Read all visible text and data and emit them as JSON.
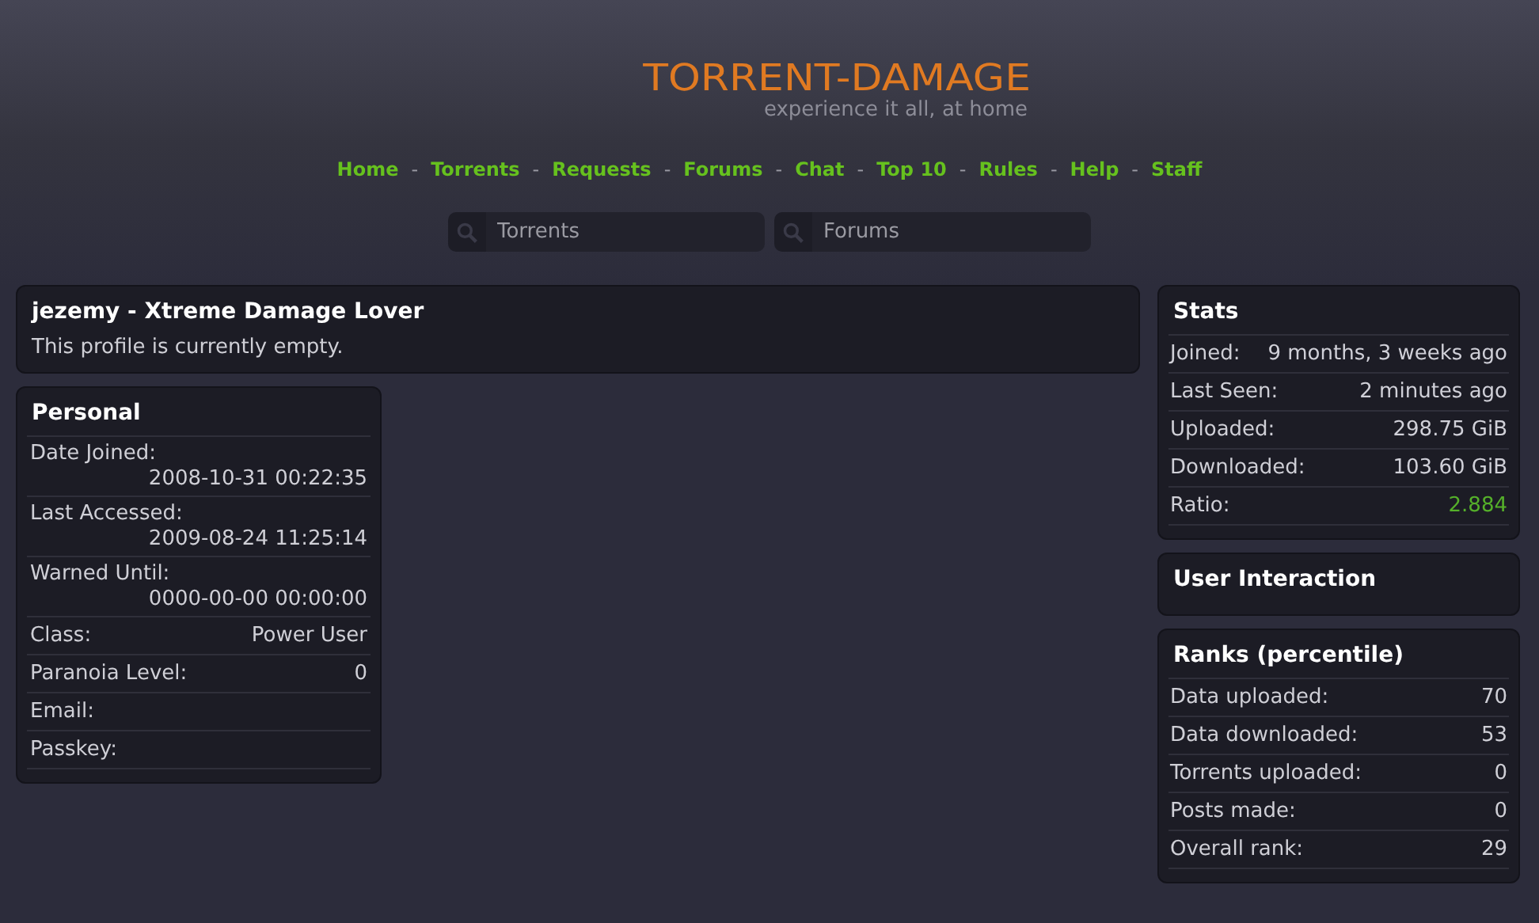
{
  "header": {
    "logo": "TORRENT-DAMAGE",
    "tagline": "experience it all, at home"
  },
  "nav": {
    "separator": "-",
    "links": [
      "Home",
      "Torrents",
      "Requests",
      "Forums",
      "Chat",
      "Top 10",
      "Rules",
      "Help",
      "Staff"
    ]
  },
  "search_fields": [
    {
      "placeholder": "Torrents"
    },
    {
      "placeholder": "Forums"
    }
  ],
  "profile": {
    "title": "jezemy - Xtreme Damage Lover",
    "body": "This profile is currently empty."
  },
  "personal": {
    "title": "Personal",
    "rows": [
      {
        "kind": "stacked",
        "label": "Date Joined:",
        "value": "2008-10-31 00:22:35"
      },
      {
        "kind": "stacked",
        "label": "Last Accessed:",
        "value": "2009-08-24 11:25:14"
      },
      {
        "kind": "stacked",
        "label": "Warned Until:",
        "value": "0000-00-00 00:00:00"
      },
      {
        "kind": "inline",
        "label": "Class:",
        "value": "Power User"
      },
      {
        "kind": "inline",
        "label": "Paranoia Level:",
        "value": "0"
      },
      {
        "kind": "inline",
        "label": "Email:"
      },
      {
        "kind": "inline",
        "label": "Passkey:"
      }
    ]
  },
  "stats": {
    "title": "Stats",
    "rows": [
      {
        "label": "Joined:",
        "value": "9 months, 3 weeks ago",
        "color": "#d0d0d8"
      },
      {
        "label": "Last Seen:",
        "value": "2 minutes ago",
        "color": "#d0d0d8"
      },
      {
        "label": "Uploaded:",
        "value": "298.75 GiB",
        "color": "#d0d0d8"
      },
      {
        "label": "Downloaded:",
        "value": "103.60 GiB",
        "color": "#d0d0d8"
      },
      {
        "label": "Ratio:",
        "value": "2.884",
        "color": "#55b02a"
      }
    ]
  },
  "user_interaction": {
    "title": "User Interaction"
  },
  "ranks": {
    "title": "Ranks (percentile)",
    "rows": [
      {
        "label": "Data uploaded:",
        "value": "70"
      },
      {
        "label": "Data downloaded:",
        "value": "53"
      },
      {
        "label": "Torrents uploaded:",
        "value": "0"
      },
      {
        "label": "Posts made:",
        "value": "0"
      },
      {
        "label": "Overall rank:",
        "value": "29"
      }
    ]
  }
}
